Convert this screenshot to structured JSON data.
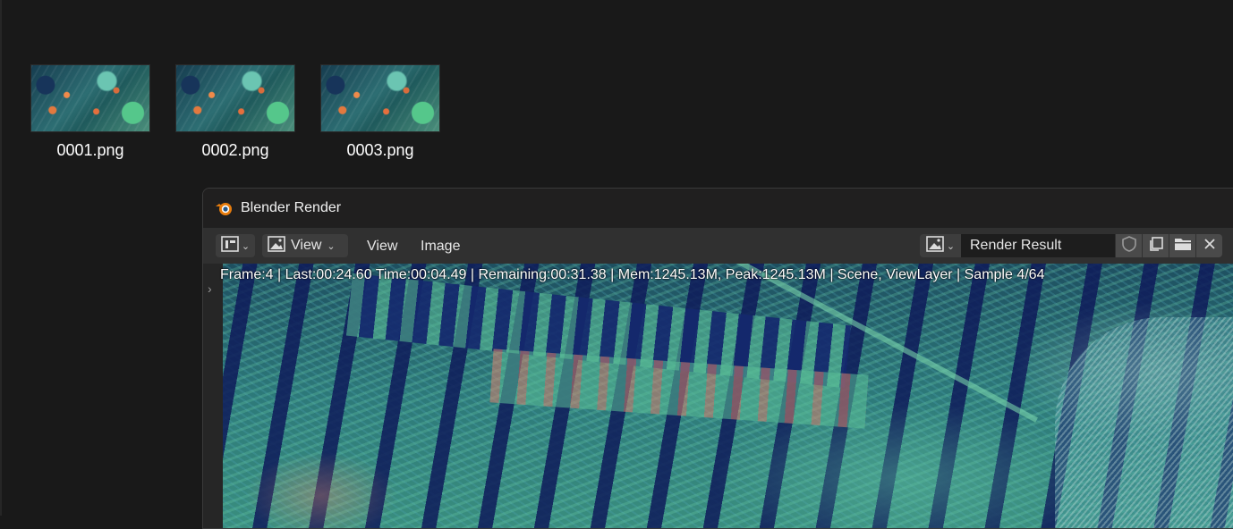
{
  "desktop": {
    "files": [
      {
        "name": "0001.png"
      },
      {
        "name": "0002.png"
      },
      {
        "name": "0003.png"
      }
    ]
  },
  "window": {
    "title": "Blender Render",
    "header": {
      "view_dropdown_label": "View",
      "menu": {
        "view": "View",
        "image": "Image"
      },
      "image_name": "Render Result"
    },
    "status_line": "Frame:4 | Last:00:24.60 Time:00:04.49 | Remaining:00:31.38 | Mem:1245.13M, Peak:1245.13M | Scene, ViewLayer | Sample 4/64"
  },
  "icons": {
    "blender_logo": "blender-logo-icon",
    "editor_type": "image-editor-icon",
    "image_browse": "image-icon",
    "fake_user": "shield-icon",
    "new_image": "duplicate-icon",
    "open_image": "folder-icon",
    "unlink": "close-icon"
  },
  "colors": {
    "blender_orange": "#e87d0d",
    "blender_blue": "#265787",
    "desktop_bg": "#191919",
    "header_bg": "#303030"
  }
}
